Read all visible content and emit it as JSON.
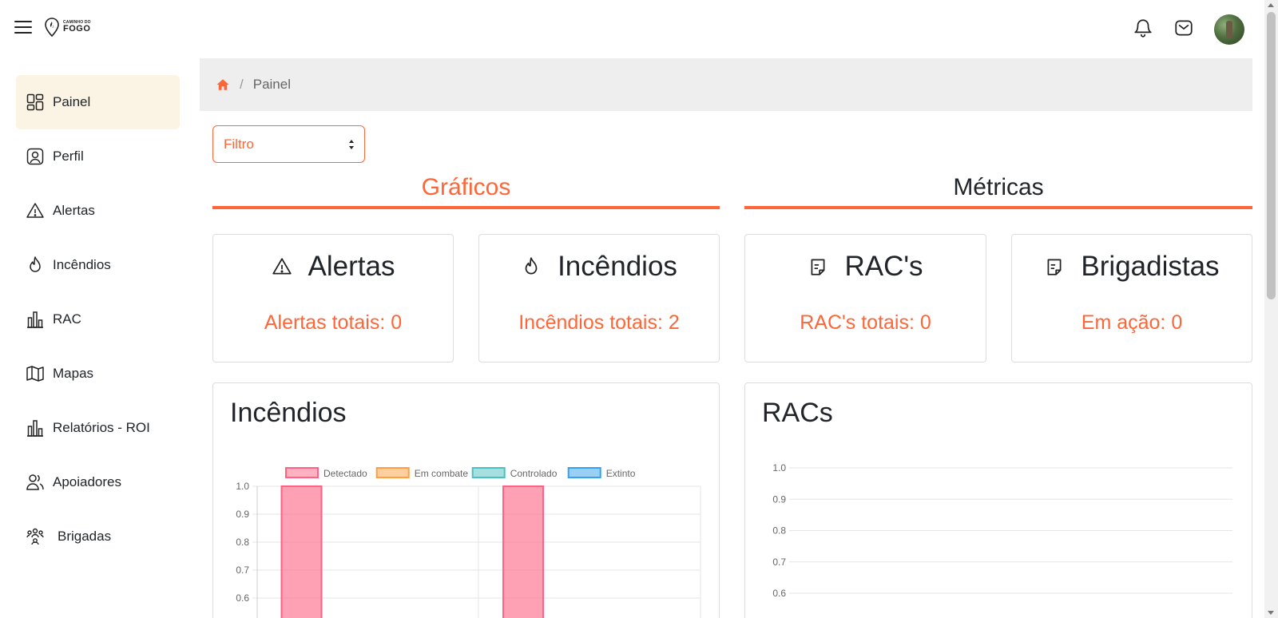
{
  "header": {
    "logo_top": "CAMINHO DO",
    "logo_bottom": "FOGO",
    "icons": [
      "menu-icon",
      "bell-icon",
      "mail-icon",
      "avatar"
    ]
  },
  "sidebar": {
    "items": [
      {
        "label": "Painel",
        "icon": "dashboard-icon",
        "active": true
      },
      {
        "label": "Perfil",
        "icon": "profile-icon"
      },
      {
        "label": "Alertas",
        "icon": "alert-icon"
      },
      {
        "label": "Incêndios",
        "icon": "fire-icon"
      },
      {
        "label": "RAC",
        "icon": "bar-chart-icon"
      },
      {
        "label": "Mapas",
        "icon": "map-icon"
      },
      {
        "label": "Relatórios - ROI",
        "icon": "bar-chart-icon"
      },
      {
        "label": "Apoiadores",
        "icon": "supporters-icon"
      },
      {
        "label": "Brigadas",
        "icon": "brigades-icon"
      }
    ]
  },
  "breadcrumb": {
    "current": "Painel",
    "separator": "/"
  },
  "filter": {
    "label": "Filtro"
  },
  "sections": {
    "graficos": "Gráficos",
    "metricas": "Métricas"
  },
  "cards": [
    {
      "title": "Alertas",
      "value": "Alertas totais: 0",
      "icon": "alert-icon"
    },
    {
      "title": "Incêndios",
      "value": "Incêndios totais: 2",
      "icon": "fire-icon"
    },
    {
      "title": "RAC's",
      "value": "RAC's totais: 0",
      "icon": "document-icon"
    },
    {
      "title": "Brigadistas",
      "value": "Em ação: 0",
      "icon": "document-icon"
    }
  ],
  "colors": {
    "accent": "#fd6638",
    "active_bg": "#fbf3e3",
    "breadcrumb_bg": "#eeeeee"
  },
  "chart_data": [
    {
      "type": "bar",
      "title": "Incêndios",
      "categories": [
        "",
        ""
      ],
      "series": [
        {
          "name": "Detectado",
          "values": [
            1,
            1
          ],
          "color": "#ff6384"
        },
        {
          "name": "Em combate",
          "values": [
            0,
            0
          ],
          "color": "#ff9f40"
        },
        {
          "name": "Controlado",
          "values": [
            0,
            0
          ],
          "color": "#4bc0c0"
        },
        {
          "name": "Extinto",
          "values": [
            0,
            0
          ],
          "color": "#36a2eb"
        }
      ],
      "y_ticks": [
        "1.0",
        "0.9",
        "0.8",
        "0.7",
        "0.6"
      ],
      "ylim": [
        0,
        1
      ],
      "legend": "top"
    },
    {
      "type": "bar",
      "title": "RACs",
      "categories": [],
      "series": [],
      "y_ticks": [
        "1.0",
        "0.9",
        "0.8",
        "0.7",
        "0.6"
      ],
      "ylim": [
        0,
        1
      ]
    }
  ]
}
